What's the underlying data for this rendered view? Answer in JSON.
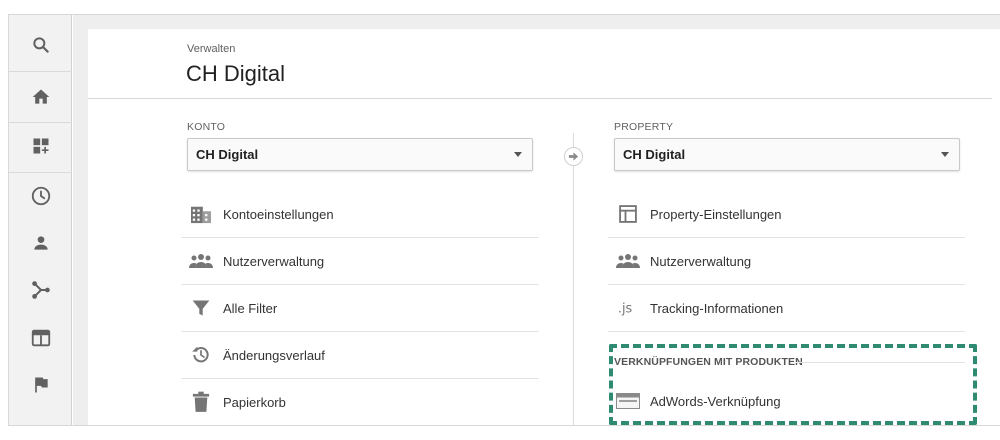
{
  "breadcrumb": "Verwalten",
  "page_title": "CH Digital",
  "rail": {
    "icons": [
      "search-icon",
      "home-icon",
      "customization-icon",
      "realtime-clock-icon",
      "audience-person-icon",
      "acquisition-icon",
      "behavior-icon",
      "conversions-flag-icon"
    ]
  },
  "account": {
    "label": "KONTO",
    "selected": "CH Digital",
    "items": [
      {
        "label": "Kontoeinstellungen",
        "icon": "building-icon"
      },
      {
        "label": "Nutzerverwaltung",
        "icon": "people-icon"
      },
      {
        "label": "Alle Filter",
        "icon": "filter-icon"
      },
      {
        "label": "Änderungsverlauf",
        "icon": "history-icon"
      },
      {
        "label": "Papierkorb",
        "icon": "trash-icon"
      }
    ]
  },
  "property": {
    "label": "PROPERTY",
    "selected": "CH Digital",
    "items": [
      {
        "label": "Property-Einstellungen",
        "icon": "layout-icon"
      },
      {
        "label": "Nutzerverwaltung",
        "icon": "people-icon"
      },
      {
        "label": "Tracking-Informationen",
        "icon": "js-icon"
      }
    ],
    "product_linking": {
      "title": "VERKNÜPFUNGEN MIT PRODUKTEN",
      "items": [
        {
          "label": "AdWords-Verknüpfung",
          "icon": "adwords-card-icon"
        }
      ]
    }
  },
  "colors": {
    "highlight": "#2e8b72",
    "icon_gray": "#757575",
    "rail_icon": "#616161"
  }
}
